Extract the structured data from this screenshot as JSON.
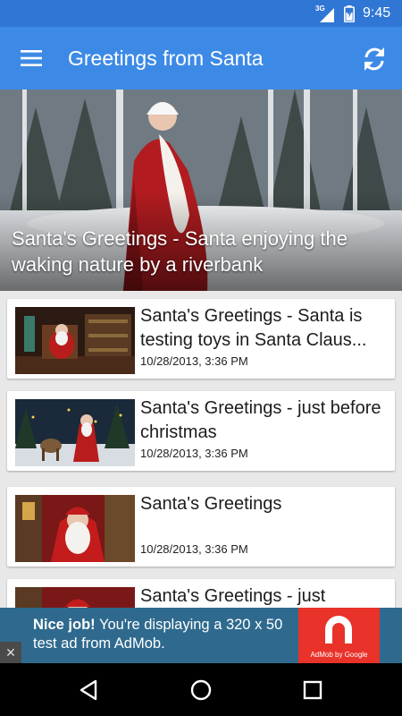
{
  "status_bar": {
    "network": "3G",
    "time": "9:45"
  },
  "app_bar": {
    "title": "Greetings from Santa",
    "menu_icon": "hamburger-menu-icon",
    "refresh_icon": "refresh-icon"
  },
  "featured": {
    "title": "Santa's Greetings - Santa enjoying the waking nature by a riverbank"
  },
  "videos": [
    {
      "title": "Santa's Greetings - Santa is testing toys in Santa Claus...",
      "date": "10/28/2013, 3:36 PM"
    },
    {
      "title": "Santa's Greetings - just before christmas",
      "date": "10/28/2013, 3:36 PM"
    },
    {
      "title": "Santa's Greetings",
      "date": "10/28/2013, 3:36 PM"
    },
    {
      "title": "Santa's Greetings - just",
      "date": ""
    }
  ],
  "ad": {
    "headline": "Nice job!",
    "body": "You're displaying a 320 x 50 test ad from AdMob.",
    "brand": "AdMob by Google",
    "close_glyph": "✕"
  },
  "colors": {
    "status_bar": "#3076d4",
    "app_bar": "#3d8ae6",
    "ad_background": "#2f6a8e",
    "ad_logo": "#e8322a"
  }
}
